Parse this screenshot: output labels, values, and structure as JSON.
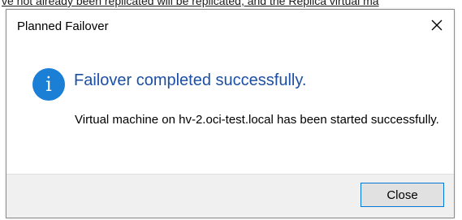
{
  "background": {
    "partial_text": "ve not already been replicated will be replicated, and the Replica virtual ma"
  },
  "dialog": {
    "title": "Planned Failover",
    "close_icon": "close-icon",
    "status_icon": "info-icon",
    "status_glyph": "i",
    "main_instruction": "Failover completed successfully.",
    "message": "Virtual machine on hv-2.oci-test.local has been started successfully.",
    "close_button_label": "Close"
  },
  "colors": {
    "accent": "#1c7fd6",
    "instruction_text": "#1c4fa5",
    "button_border": "#0078d7",
    "footer_bg": "#f0f0f0"
  }
}
